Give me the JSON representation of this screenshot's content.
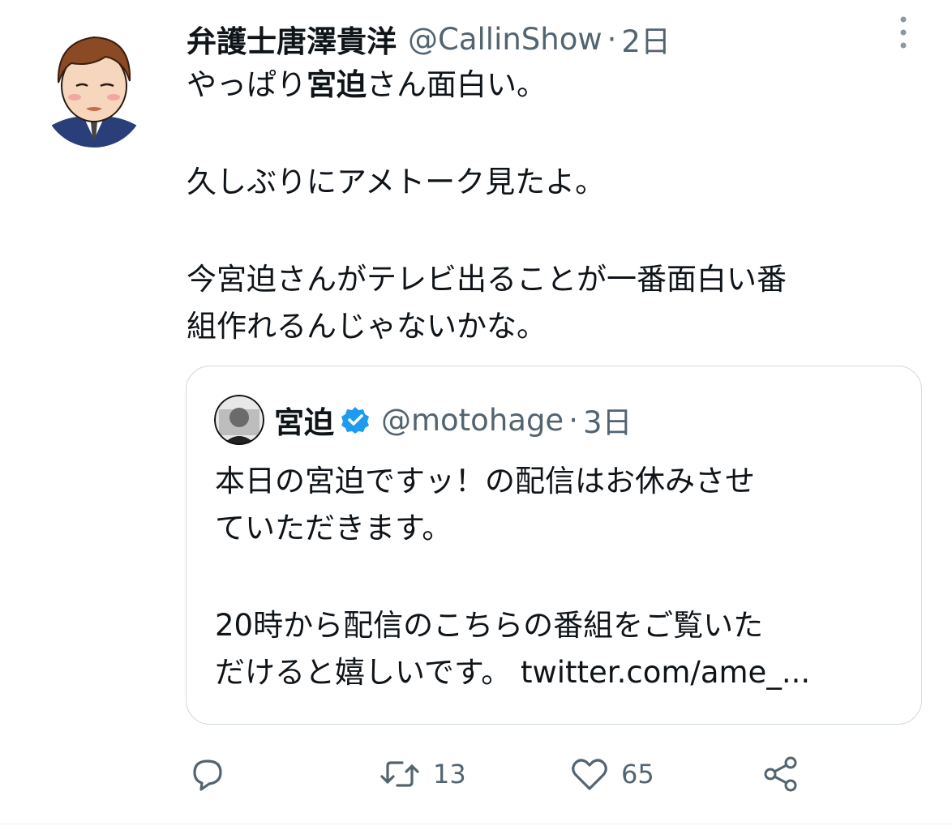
{
  "tweet": {
    "author_name": "弁護士唐澤貴洋",
    "author_handle": "@CallinShow",
    "separator": "·",
    "timestamp": "2日",
    "text_line1_pre": "やっぱり",
    "text_line1_bold": "宮迫",
    "text_line1_post": "さん面白い。",
    "text_line2": "久しぶりにアメトーク見たよ。",
    "text_line3": "今宮迫さんがテレビ出ることが一番面白い番",
    "text_line4": "組作れるんじゃないかな。"
  },
  "quote": {
    "author_name": "宮迫",
    "author_handle": "@motohage",
    "separator": "·",
    "timestamp": "3日",
    "line1": "本日の宮迫ですッ！の配信はお休みさせ",
    "line2": "ていただきます。",
    "line3": "20時から配信のこちらの番組をご覧いた",
    "line4": "だけると嬉しいです。 twitter.com/ame_..."
  },
  "actions": {
    "retweet_count": "13",
    "like_count": "65"
  },
  "colors": {
    "text": "#0f1419",
    "secondary": "#536471",
    "border": "#cfd9de",
    "verified": "#1d9bf0"
  },
  "icons": [
    "more-icon",
    "reply-icon",
    "retweet-icon",
    "like-icon",
    "share-icon",
    "verified-icon"
  ]
}
